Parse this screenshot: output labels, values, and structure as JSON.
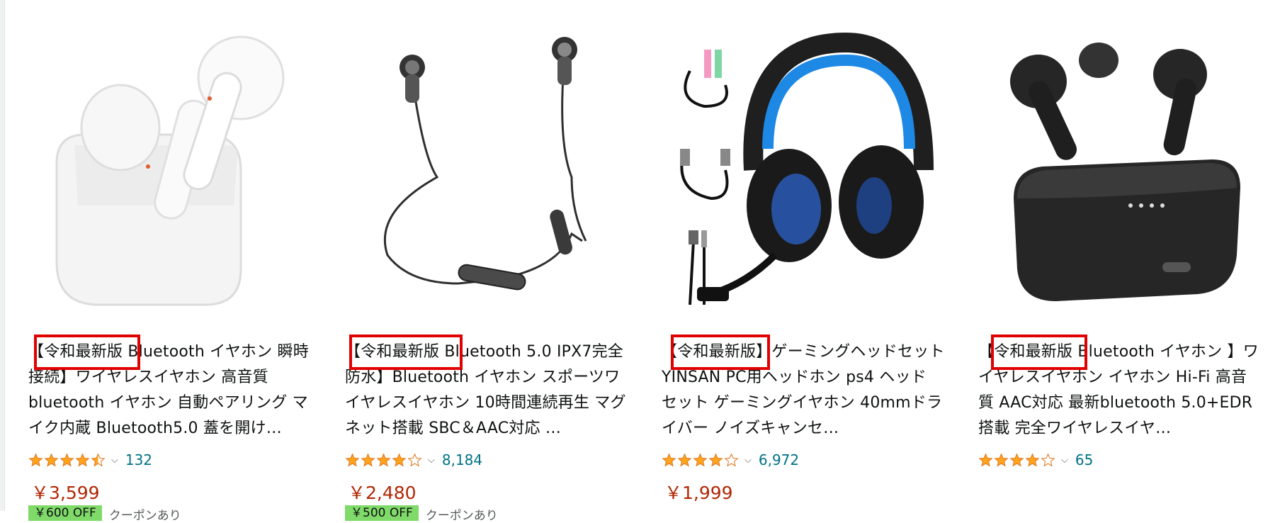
{
  "products": [
    {
      "title": "【令和最新版 Bluetooth イヤホン 瞬時接続】ワイヤレスイヤホン 高音質 bluetooth イヤホン 自動ペアリング マイク内蔵 Bluetooth5.0 蓋を開け…",
      "highlight_text": "令和最新版",
      "rating": 4.5,
      "rating_count": "132",
      "price": "￥3,599",
      "coupon_badge": "￥600 OFF",
      "coupon_text": "クーポンあり",
      "image": "white-earbuds-case"
    },
    {
      "title": "【令和最新版 Bluetooth 5.0 IPX7完全防水】Bluetooth イヤホン スポーツワイヤレスイヤホン 10時間連続再生 マグネット搭載 SBC＆AAC対応 …",
      "highlight_text": "令和最新版",
      "rating": 4.0,
      "rating_count": "8,184",
      "price": "￥2,480",
      "coupon_badge": "￥500 OFF",
      "coupon_text": "クーポンあり",
      "image": "neckband-earphones"
    },
    {
      "title": "【令和最新版】ゲーミングヘッドセット YINSAN PC用ヘッドホン ps4 ヘッド セット ゲーミングイヤホン 40mmドライバー ノイズキャンセ…",
      "highlight_text": "令和最新版",
      "rating": 4.0,
      "rating_count": "6,972",
      "price": "￥1,999",
      "image": "gaming-headset"
    },
    {
      "title": "【令和最新版 Bluetooth イヤホン 】ワイヤレスイヤホン イヤホン Hi-Fi 高音質 AAC対応 最新bluetooth 5.0+EDR搭載 完全ワイヤレスイヤ…",
      "highlight_text": "令和最新版",
      "rating": 4.0,
      "rating_count": "65",
      "price": null,
      "image": "black-earbuds-case"
    }
  ],
  "colors": {
    "accent_red": "#e10000",
    "price": "#b12704",
    "link": "#007185",
    "star": "#ffa41c"
  }
}
